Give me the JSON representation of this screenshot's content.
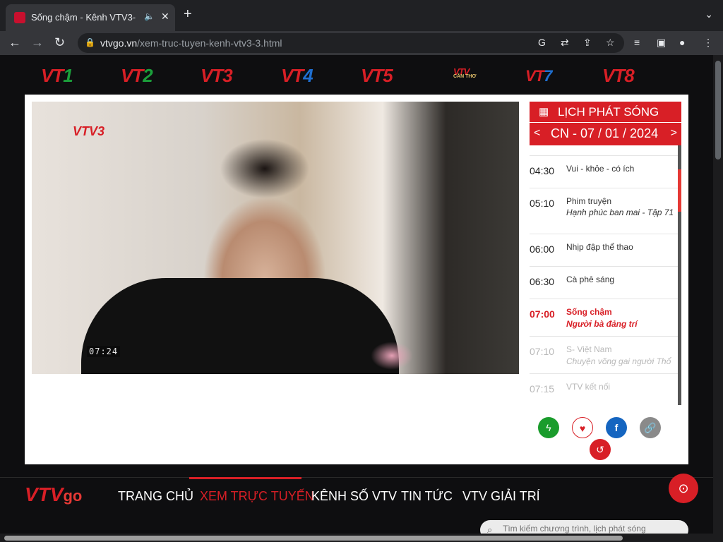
{
  "browser": {
    "tab_title": "Sống chậm - Kênh VTV3-",
    "tab_audio_icon": "speaker-icon",
    "url_host": "vtvgo.vn",
    "url_path": "/xem-truc-tuyen-kenh-vtv3-3.html"
  },
  "channels": [
    {
      "pre": "VT",
      "num": "1"
    },
    {
      "pre": "VT",
      "num": "2"
    },
    {
      "pre": "VT",
      "num": "3"
    },
    {
      "pre": "VT",
      "num": "4"
    },
    {
      "pre": "VT",
      "num": "5"
    },
    {
      "pre": "VTV",
      "sub": "CẦN THƠ"
    },
    {
      "pre": "VT",
      "num": "7"
    },
    {
      "pre": "VT",
      "num": "8"
    }
  ],
  "video": {
    "logo": "VTV3",
    "timestamp": "07:24"
  },
  "schedule": {
    "title": "LỊCH PHÁT SÓNG",
    "date": "CN - 07 / 01 / 2024",
    "prev": "<",
    "next": ">",
    "items": [
      {
        "time": "04:30",
        "title": "Vui - khỏe - có ích",
        "sub": ""
      },
      {
        "time": "05:10",
        "title": "Phim truyện",
        "sub": "Hạnh phúc ban mai - Tập 71"
      },
      {
        "time": "06:00",
        "title": "Nhịp đập thể thao",
        "sub": ""
      },
      {
        "time": "06:30",
        "title": "Cà phê sáng",
        "sub": ""
      },
      {
        "time": "07:00",
        "title": "Sống chậm",
        "sub": "Người bà đảng trí"
      },
      {
        "time": "07:10",
        "title": "S- Việt Nam",
        "sub": "Chuyện võng gai người Thổ"
      },
      {
        "time": "07:15",
        "title": "VTV kết nối",
        "sub": ""
      }
    ]
  },
  "share": {
    "icons": [
      "lightning-icon",
      "heart-icon",
      "facebook-icon",
      "link-icon",
      "refresh-icon"
    ],
    "colors": {
      "lightning": "#1a9c2c",
      "heart": "#d81f26",
      "facebook": "#1565c0",
      "link": "#8a8a8a",
      "refresh": "#d81f26"
    }
  },
  "footer": {
    "brand": "VTV",
    "brand_go": "go",
    "nav": [
      "TRANG CHỦ",
      "XEM TRỰC TUYẾN",
      "KÊNH SỐ VTV",
      "TIN TỨC",
      "VTV GIẢI TRÍ"
    ],
    "search_placeholder": "Tìm kiếm chương trình, lịch phát sóng"
  },
  "colors": {
    "brand_red": "#d81f26",
    "background": "#0e0e10"
  }
}
